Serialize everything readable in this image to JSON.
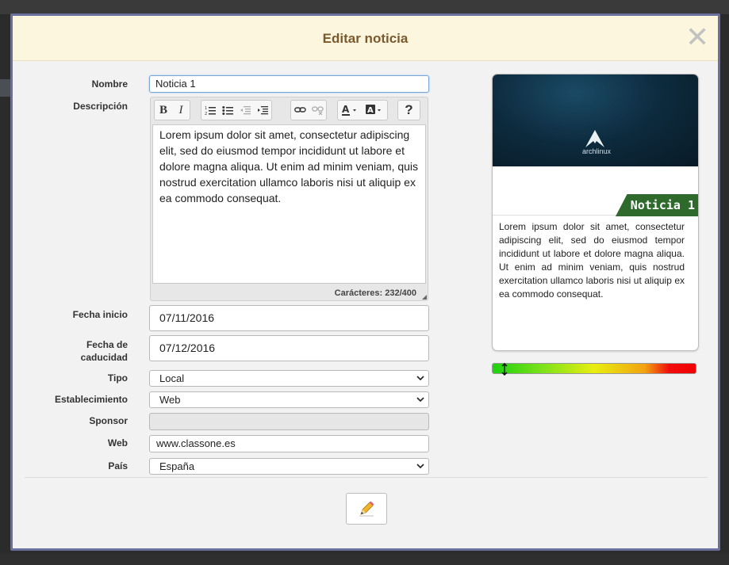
{
  "modal": {
    "title": "Editar noticia",
    "close_glyph": "✕"
  },
  "form": {
    "nombre": {
      "label": "Nombre",
      "value": "Noticia 1"
    },
    "descripcion": {
      "label": "Descripción",
      "text": "Lorem ipsum dolor sit amet, consectetur adipiscing elit, sed do eiusmod tempor incididunt ut labore et dolore magna aliqua. Ut enim ad minim veniam, quis nostrud exercitation ullamco laboris nisi ut aliquip ex ea commodo consequat.",
      "counter": "Carácteres: 232/400"
    },
    "fecha_inicio": {
      "label": "Fecha inicio",
      "value": "07/11/2016"
    },
    "fecha_caducidad": {
      "label_line1": "Fecha de",
      "label_line2": "caducidad",
      "value": "07/12/2016"
    },
    "tipo": {
      "label": "Tipo",
      "value": "Local"
    },
    "establecimiento": {
      "label": "Establecimiento",
      "value": "Web"
    },
    "sponsor": {
      "label": "Sponsor",
      "value": ""
    },
    "web": {
      "label": "Web",
      "value": "www.classone.es"
    },
    "pais": {
      "label": "País",
      "value": "España"
    }
  },
  "toolbar": {
    "bold": "B",
    "italic": "I",
    "help": "?",
    "icons": [
      "bold-icon",
      "italic-icon",
      "ordered-list-icon",
      "unordered-list-icon",
      "outdent-icon",
      "indent-icon",
      "link-icon",
      "unlink-icon",
      "font-color-icon",
      "background-color-icon",
      "help-icon"
    ]
  },
  "preview": {
    "logo_text": "archlinux",
    "badge": "Noticia 1",
    "text": "Lorem ipsum dolor sit amet, consectetur adipiscing elit, sed do eiusmod tempor incididunt ut labore et dolore magna aliqua. Ut enim ad minim veniam, quis nostrud exercitation ullamco laboris nisi ut aliquip ex ea commodo consequat."
  },
  "footer": {
    "edit_icon": "pencil-icon"
  },
  "colors": {
    "header_bg": "#fcf6df",
    "title": "#7a5a2d",
    "badge_bg": "#2f6a2d",
    "modal_border": "#6b6f9e"
  }
}
